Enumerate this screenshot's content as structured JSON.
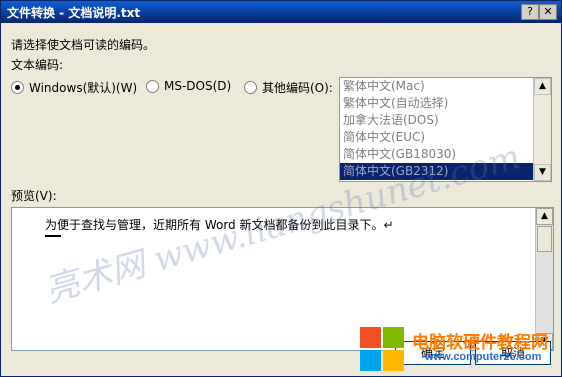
{
  "window": {
    "title": "文件转换 - 文档说明.txt",
    "help_glyph": "?",
    "close_glyph": "✕"
  },
  "prompt": "请选择使文档可读的编码。",
  "encoding_label": "文本编码:",
  "options": [
    {
      "label": "Windows(默认)(W)",
      "checked": true
    },
    {
      "label": "MS-DOS(D)",
      "checked": false
    },
    {
      "label": "其他编码(O):",
      "checked": false
    }
  ],
  "encodings": [
    "繁体中文(Mac)",
    "繁体中文(自动选择)",
    "加拿大法语(DOS)",
    "简体中文(EUC)",
    "简体中文(GB18030)",
    "简体中文(GB2312)"
  ],
  "selected_encoding": "简体中文(GB2312)",
  "preview_label": "预览(V):",
  "preview_text": "为便于查找与管理，近期所有 Word 新文档都备份到此目录下。↵",
  "buttons": {
    "ok": "确定",
    "cancel": "取消"
  },
  "watermark": {
    "brand": "电脑软硬件教程网",
    "url": "www.computer26.com",
    "diag": "亮术网 www.liangshunet.com",
    "logo_colors": [
      "#f25022",
      "#7fba00",
      "#00a4ef",
      "#ffb900"
    ]
  }
}
